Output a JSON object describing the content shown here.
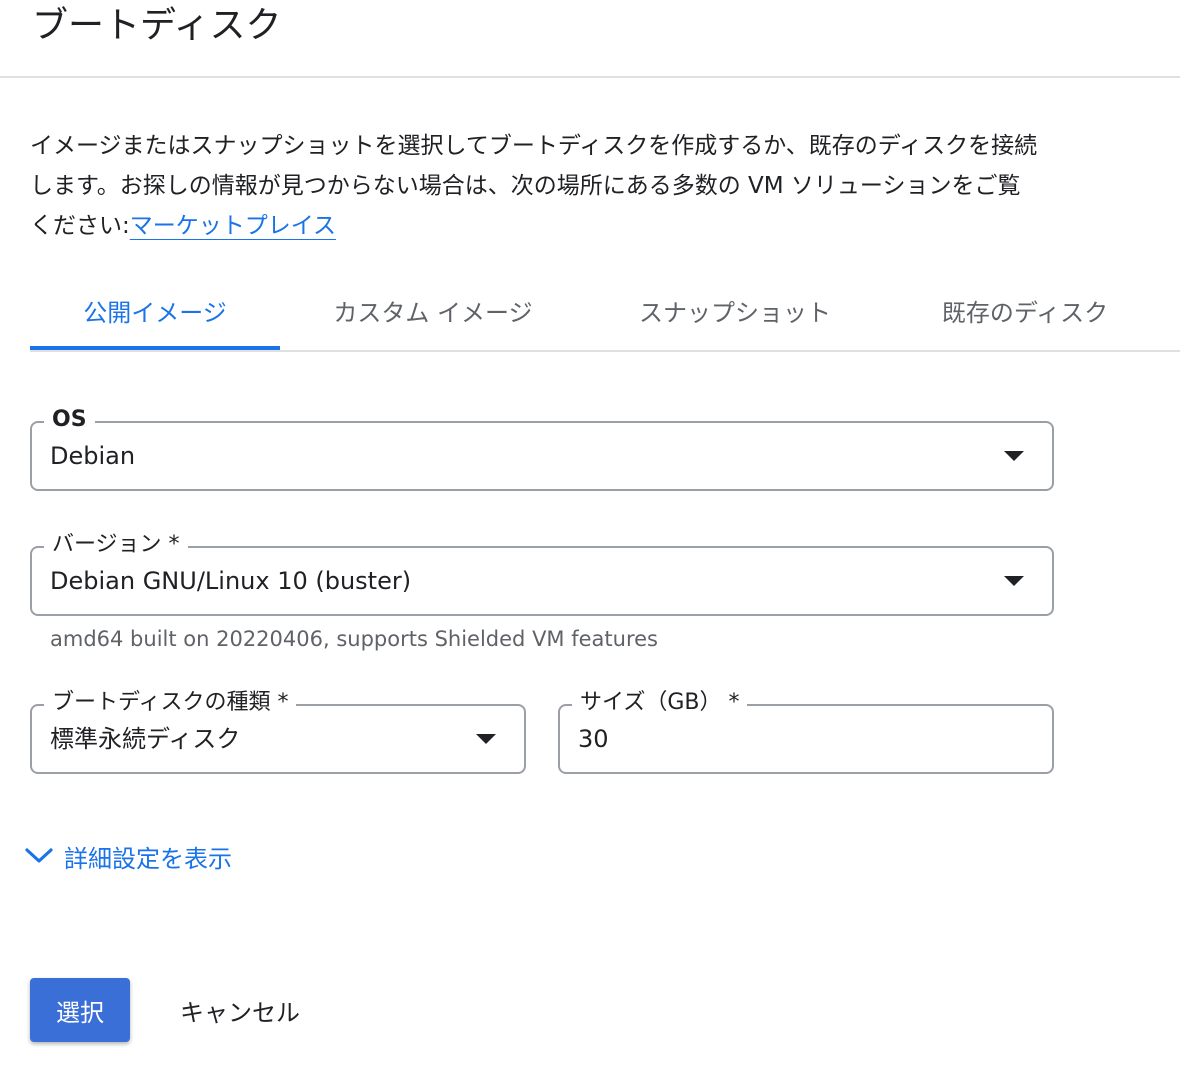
{
  "header": {
    "title": "ブートディスク"
  },
  "description": {
    "text": "イメージまたはスナップショットを選択してブートディスクを作成するか、既存のディスクを接続します。お探しの情報が見つからない場合は、次の場所にある多数の VM ソリューションをご覧ください:",
    "link_text": "マーケットプレイス"
  },
  "tabs": [
    {
      "label": "公開イメージ",
      "active": true
    },
    {
      "label": "カスタム イメージ",
      "active": false
    },
    {
      "label": "スナップショット",
      "active": false
    },
    {
      "label": "既存のディスク",
      "active": false
    }
  ],
  "os_field": {
    "label": "OS",
    "value": "Debian"
  },
  "version_field": {
    "label": "バージョン *",
    "value": "Debian GNU/Linux 10 (buster)",
    "helper": "amd64 built on 20220406, supports Shielded VM features"
  },
  "disk_type_field": {
    "label": "ブートディスクの種類 *",
    "value": "標準永続ディスク"
  },
  "size_field": {
    "label": "サイズ（GB） *",
    "value": "30"
  },
  "advanced": {
    "label": "詳細設定を表示",
    "icon": "chevron-down-icon"
  },
  "actions": {
    "select_label": "選択",
    "cancel_label": "キャンセル"
  },
  "colors": {
    "accent": "#1a73e8",
    "primary_button": "#3b6fd8"
  }
}
